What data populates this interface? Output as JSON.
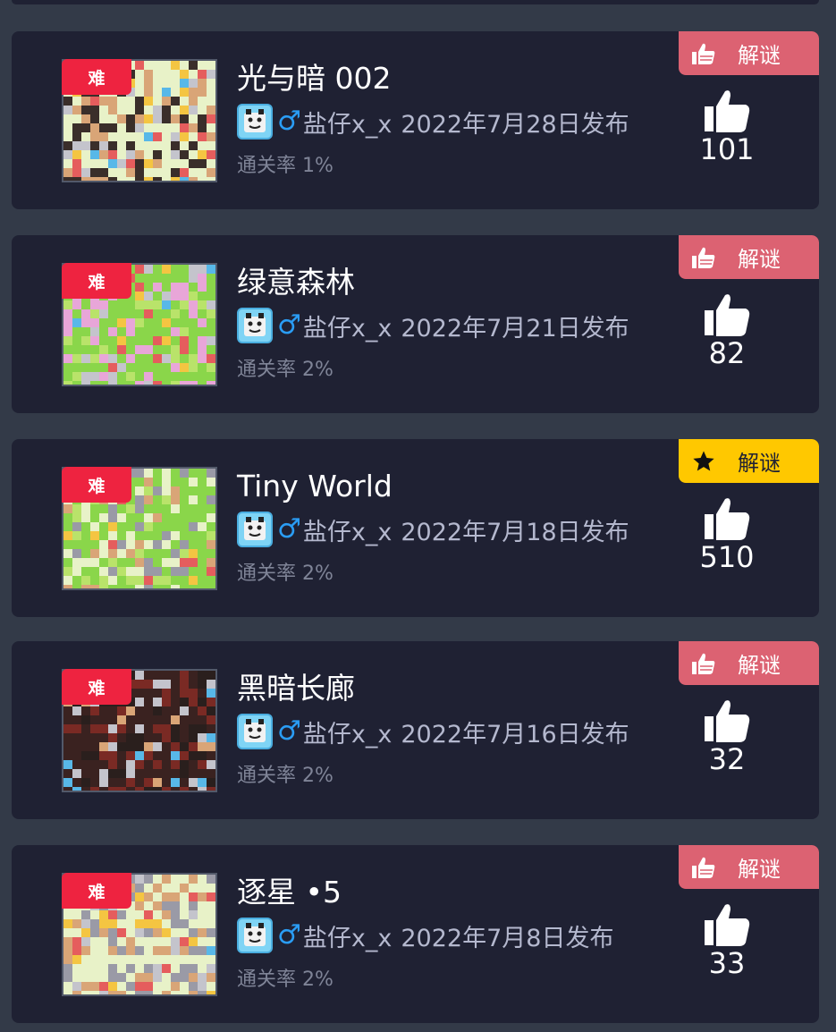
{
  "levels": [
    {
      "difficulty": "难",
      "title": "光与暗 002",
      "gender_symbol": "♂",
      "author": "盐仔x_x",
      "date": "2022年7月28日发布",
      "pass_rate": "通关率 1%",
      "tag": {
        "icon": "thumbs-up-icon",
        "label": "解谜",
        "color": "#dc6272"
      },
      "likes": "101",
      "thumb_palette": [
        "#e8f2c8",
        "#3a2e2a",
        "#d9a577",
        "#c4c4cc",
        "#e55d5d",
        "#f4c542",
        "#58b8e8"
      ]
    },
    {
      "difficulty": "难",
      "title": "绿意森林",
      "gender_symbol": "♂",
      "author": "盐仔x_x",
      "date": "2022年7月21日发布",
      "pass_rate": "通关率 2%",
      "tag": {
        "icon": "thumbs-up-icon",
        "label": "解谜",
        "color": "#dc6272"
      },
      "likes": "82",
      "thumb_palette": [
        "#8ad64a",
        "#e8a6d8",
        "#b9e36a",
        "#c4c4cc",
        "#e55d5d",
        "#f4c542",
        "#58b8e8"
      ]
    },
    {
      "difficulty": "难",
      "title": "Tiny World",
      "gender_symbol": "♂",
      "author": "盐仔x_x",
      "date": "2022年7月18日发布",
      "pass_rate": "通关率 2%",
      "tag": {
        "icon": "star-icon",
        "label": "解谜",
        "color": "#ffc800"
      },
      "likes": "510",
      "thumb_palette": [
        "#8ad64a",
        "#e8f2c8",
        "#b9e36a",
        "#9a9aa6",
        "#d9a577",
        "#f4c542",
        "#e55d5d"
      ]
    },
    {
      "difficulty": "难",
      "title": "黑暗长廊",
      "gender_symbol": "♂",
      "author": "盐仔x_x",
      "date": "2022年7月16日发布",
      "pass_rate": "通关率 2%",
      "tag": {
        "icon": "thumbs-up-icon",
        "label": "解谜",
        "color": "#dc6272"
      },
      "likes": "32",
      "thumb_palette": [
        "#3a2220",
        "#7a2a24",
        "#2a1f1d",
        "#c4c4cc",
        "#d9a577",
        "#58b8e8",
        "#e55d5d"
      ]
    },
    {
      "difficulty": "难",
      "title": "逐星 •5",
      "gender_symbol": "♂",
      "author": "盐仔x_x",
      "date": "2022年7月8日发布",
      "pass_rate": "通关率 2%",
      "tag": {
        "icon": "thumbs-up-icon",
        "label": "解谜",
        "color": "#dc6272"
      },
      "likes": "33",
      "thumb_palette": [
        "#e8f2c8",
        "#9a9aa6",
        "#d9a577",
        "#c4c4cc",
        "#e55d5d",
        "#f4c542",
        "#58b8e8"
      ]
    }
  ]
}
